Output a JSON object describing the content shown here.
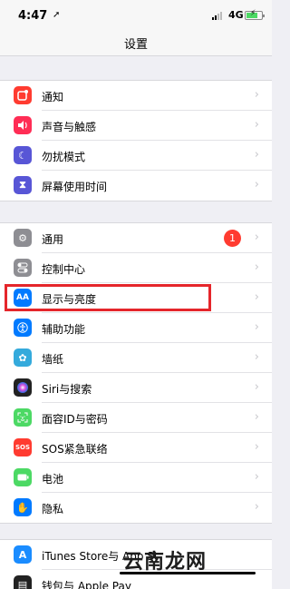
{
  "status": {
    "time": "4:47",
    "network": "4G"
  },
  "nav": {
    "title": "设置"
  },
  "group1": [
    {
      "label": "通知",
      "icon": "notification-icon",
      "color": "#ff3b30"
    },
    {
      "label": "声音与触感",
      "icon": "sound-icon",
      "color": "#ff2d55"
    },
    {
      "label": "勿扰模式",
      "icon": "moon-icon",
      "color": "#5856d6"
    },
    {
      "label": "屏幕使用时间",
      "icon": "hourglass-icon",
      "color": "#5856d6"
    }
  ],
  "group2": [
    {
      "label": "通用",
      "icon": "gear-icon",
      "color": "#8e8e93",
      "badge": "1"
    },
    {
      "label": "控制中心",
      "icon": "toggle-icon",
      "color": "#8e8e93"
    },
    {
      "label": "显示与亮度",
      "icon": "text-size-icon",
      "color": "#007aff",
      "glyph": "AA"
    },
    {
      "label": "辅助功能",
      "icon": "accessibility-icon",
      "color": "#007aff"
    },
    {
      "label": "墙纸",
      "icon": "flower-icon",
      "color": "#34aadc"
    },
    {
      "label": "Siri与搜索",
      "icon": "siri-icon",
      "color": "#222222"
    },
    {
      "label": "面容ID与密码",
      "icon": "faceid-icon",
      "color": "#4cd964"
    },
    {
      "label": "SOS紧急联络",
      "icon": "sos-icon",
      "color": "#ff3b30",
      "glyph": "SOS"
    },
    {
      "label": "电池",
      "icon": "battery-icon",
      "color": "#4cd964"
    },
    {
      "label": "隐私",
      "icon": "hand-icon",
      "color": "#007aff"
    }
  ],
  "group3": [
    {
      "label": "iTunes Store与 App St",
      "icon": "appstore-icon",
      "color": "#1a8cff"
    },
    {
      "label": "钱包与 Apple Pay",
      "icon": "wallet-icon",
      "color": "#222222"
    }
  ],
  "watermark": "云南龙网"
}
